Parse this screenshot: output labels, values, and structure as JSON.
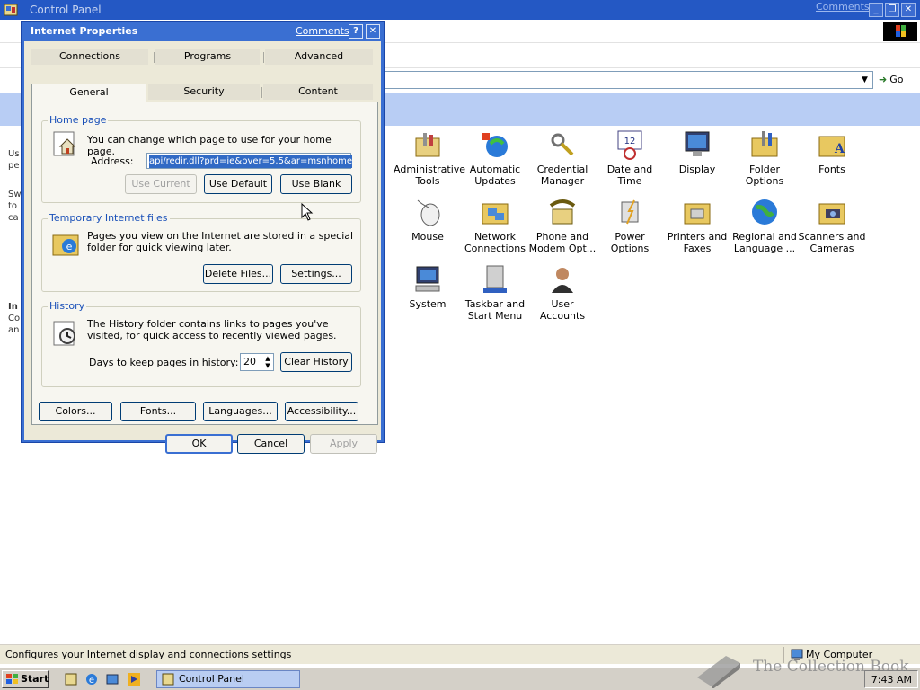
{
  "window": {
    "title": "Control Panel",
    "comments_link": "Comments?",
    "minimize": "_",
    "restore": "❐",
    "close": "✕"
  },
  "addressbar": {
    "go_label": "Go"
  },
  "leftpane_fragments": [
    "Us",
    "pe",
    "Sw",
    "to",
    "ca",
    "In",
    "Co",
    "an"
  ],
  "control_panel_items": [
    {
      "label": "Administrative Tools",
      "icon": "admin-tools-icon"
    },
    {
      "label": "Automatic Updates",
      "icon": "automatic-updates-icon"
    },
    {
      "label": "Credential Manager",
      "icon": "credential-manager-icon"
    },
    {
      "label": "Date and Time",
      "icon": "date-time-icon"
    },
    {
      "label": "Display",
      "icon": "display-icon"
    },
    {
      "label": "Folder Options",
      "icon": "folder-options-icon"
    },
    {
      "label": "Fonts",
      "icon": "fonts-icon"
    },
    {
      "label": "Mouse",
      "icon": "mouse-icon"
    },
    {
      "label": "Network Connections",
      "icon": "network-connections-icon"
    },
    {
      "label": "Phone and Modem Opt...",
      "icon": "phone-modem-icon"
    },
    {
      "label": "Power Options",
      "icon": "power-options-icon"
    },
    {
      "label": "Printers and Faxes",
      "icon": "printers-faxes-icon"
    },
    {
      "label": "Regional and Language ...",
      "icon": "regional-language-icon"
    },
    {
      "label": "Scanners and Cameras",
      "icon": "scanners-cameras-icon"
    },
    {
      "label": "System",
      "icon": "system-icon"
    },
    {
      "label": "Taskbar and Start Menu",
      "icon": "taskbar-start-menu-icon"
    },
    {
      "label": "User Accounts",
      "icon": "user-accounts-icon"
    }
  ],
  "statusbar": {
    "text": "Configures your Internet display and connections settings",
    "zone": "My Computer"
  },
  "taskbar": {
    "start": "Start",
    "task_label": "Control Panel",
    "clock": "7:43 AM"
  },
  "watermark": "The Collection Book",
  "dialog": {
    "title": "Internet Properties",
    "comments_link": "Comments?",
    "help": "?",
    "close": "✕",
    "tabs": {
      "connections": "Connections",
      "programs": "Programs",
      "advanced": "Advanced",
      "general": "General",
      "security": "Security",
      "content": "Content"
    },
    "home_page": {
      "legend": "Home page",
      "description": "You can change which page to use for your home page.",
      "address_label": "Address:",
      "address_value": "api/redir.dll?prd=ie&pver=5.5&ar=msnhome",
      "use_current": "Use Current",
      "use_default": "Use Default",
      "use_blank": "Use Blank"
    },
    "temp_files": {
      "legend": "Temporary Internet files",
      "description": "Pages you view on the Internet are stored in a special folder for quick viewing later.",
      "delete_files": "Delete Files...",
      "settings": "Settings..."
    },
    "history": {
      "legend": "History",
      "description": "The History folder contains links to pages you've visited, for quick access to recently viewed pages.",
      "days_label": "Days to keep pages in history:",
      "days_value": "20",
      "clear_history": "Clear History"
    },
    "bottom_buttons": {
      "colors": "Colors...",
      "fonts": "Fonts...",
      "languages": "Languages...",
      "accessibility": "Accessibility..."
    },
    "ok": "OK",
    "cancel": "Cancel",
    "apply": "Apply"
  }
}
